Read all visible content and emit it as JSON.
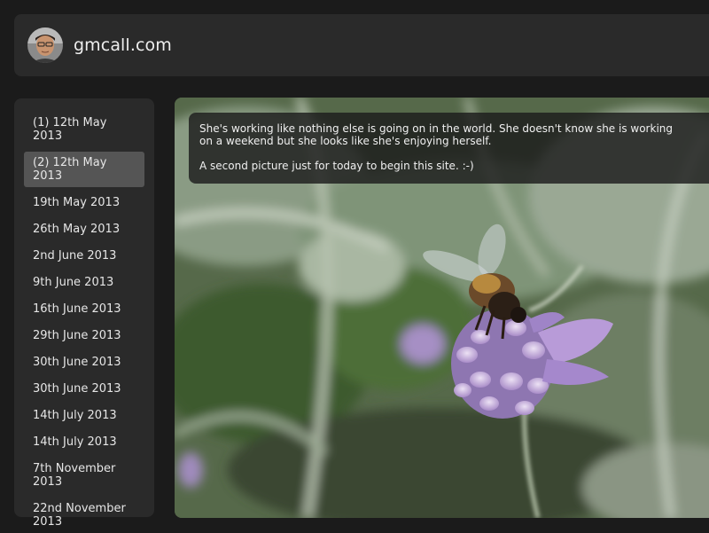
{
  "header": {
    "site_title": "gmcall.com",
    "avatar_icon": "user-avatar-photo"
  },
  "sidebar": {
    "items": [
      {
        "label": "(1) 12th May 2013",
        "active": false
      },
      {
        "label": "(2) 12th May 2013",
        "active": true
      },
      {
        "label": "19th May 2013",
        "active": false
      },
      {
        "label": "26th May 2013",
        "active": false
      },
      {
        "label": "2nd June 2013",
        "active": false
      },
      {
        "label": "9th June 2013",
        "active": false
      },
      {
        "label": "16th June 2013",
        "active": false
      },
      {
        "label": "29th June 2013",
        "active": false
      },
      {
        "label": "30th June 2013",
        "active": false
      },
      {
        "label": "30th June 2013",
        "active": false
      },
      {
        "label": "14th July 2013",
        "active": false
      },
      {
        "label": "14th July 2013",
        "active": false
      },
      {
        "label": "7th November 2013",
        "active": false
      },
      {
        "label": "22nd November 2013",
        "active": false
      }
    ]
  },
  "post": {
    "caption_paragraph_1": "She's working like nothing else is going on in the world. She doesn't know she is working on a weekend but she looks like she's enjoying herself.",
    "caption_paragraph_2": "A second picture just for today to begin this site. :-)",
    "photo_subject": "bee-on-lavender-photo"
  },
  "colors": {
    "page_background": "#1b1b1b",
    "panel_background": "#2a2a2a",
    "active_item_background": "#555555",
    "text": "#e6e6e6"
  }
}
